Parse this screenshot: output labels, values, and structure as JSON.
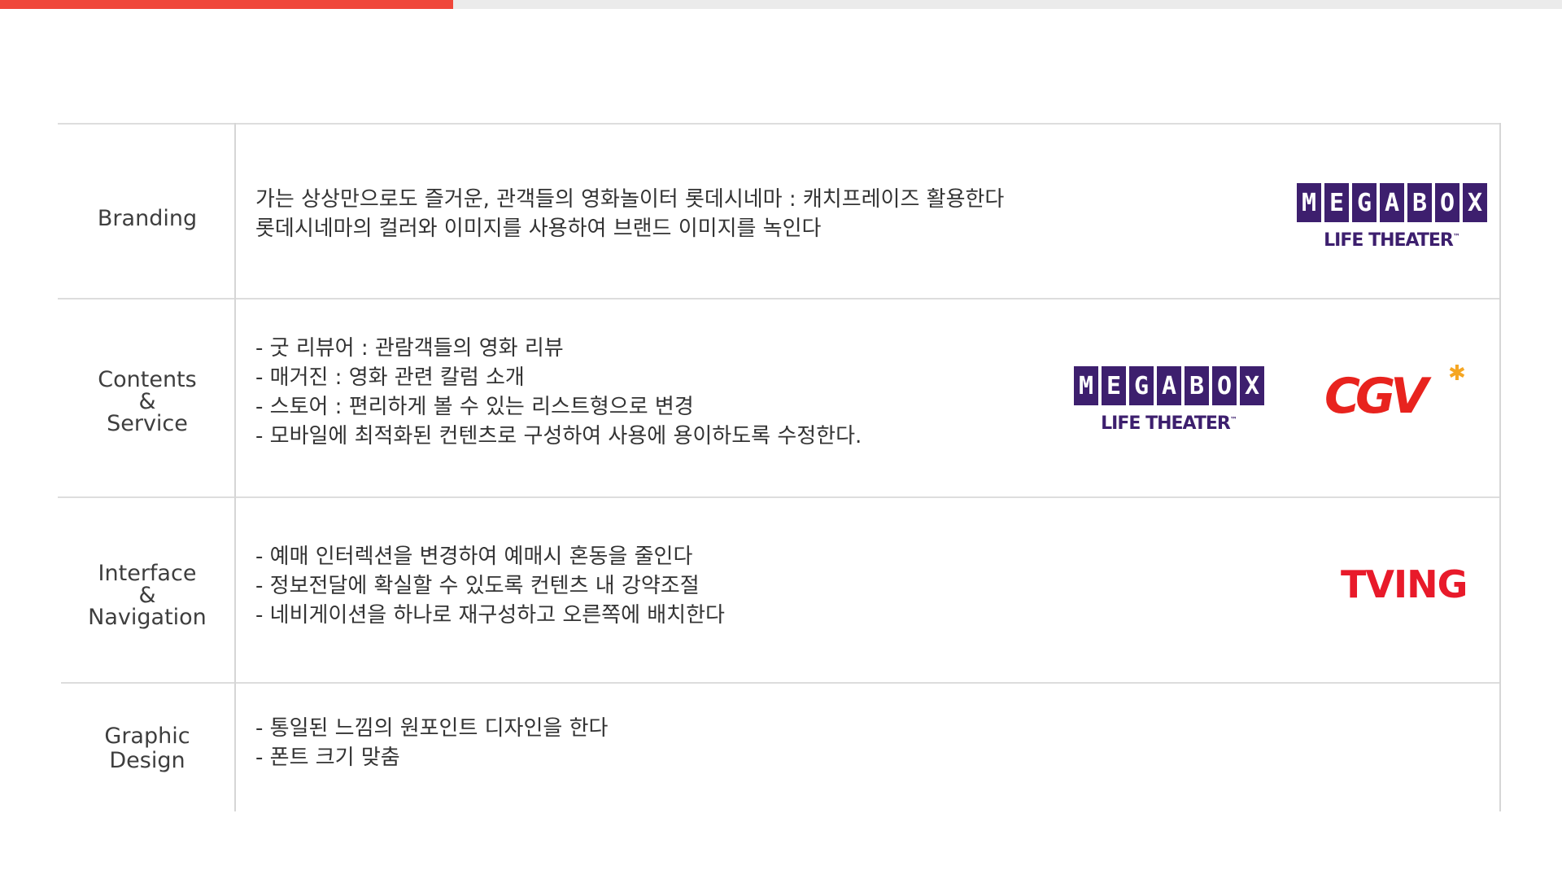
{
  "progress": {
    "fraction": 0.29,
    "fill_color": "#f0473a",
    "track_color": "#ebebeb"
  },
  "rows": [
    {
      "category_lines": [
        "Branding"
      ],
      "description": [
        "가는 상상만으로도 즐거운, 관객들의 영화놀이터 롯데시네마 : 캐치프레이즈 활용한다",
        "롯데시네마의 컬러와 이미지를 사용하여 브랜드 이미지를 녹인다"
      ]
    },
    {
      "category_lines": [
        "Contents",
        "&",
        "Service"
      ],
      "description": [
        "- 굿 리뷰어 : 관람객들의 영화 리뷰",
        "- 매거진 : 영화 관련 칼럼 소개",
        "- 스토어 : 편리하게 볼 수 있는 리스트형으로 변경",
        "- 모바일에 최적화된 컨텐츠로 구성하여 사용에 용이하도록 수정한다."
      ]
    },
    {
      "category_lines": [
        "Interface",
        "&",
        "Navigation"
      ],
      "description": [
        "- 예매 인터렉션을 변경하여 예매시 혼동을 줄인다",
        "- 정보전달에 확실할 수 있도록 컨텐츠 내 강약조절",
        "- 네비게이션을 하나로 재구성하고 오른쪽에 배치한다"
      ]
    },
    {
      "category_lines": [
        "Graphic",
        "Design"
      ],
      "description": [
        "- 통일된 느낌의 원포인트 디자인을 한다",
        "- 폰트 크기 맞춤"
      ]
    }
  ],
  "logos": {
    "megabox": {
      "letters": [
        "M",
        "E",
        "G",
        "A",
        "B",
        "O",
        "X"
      ],
      "subtitle": "LIFE THEATER",
      "trademark": "™",
      "color": "#3d1f6e"
    },
    "cgv": {
      "text": "CGV",
      "star": "✱",
      "color": "#e8231e",
      "star_color": "#f5a623"
    },
    "tving": {
      "text": "TVING",
      "color": "#e81a2a"
    }
  }
}
